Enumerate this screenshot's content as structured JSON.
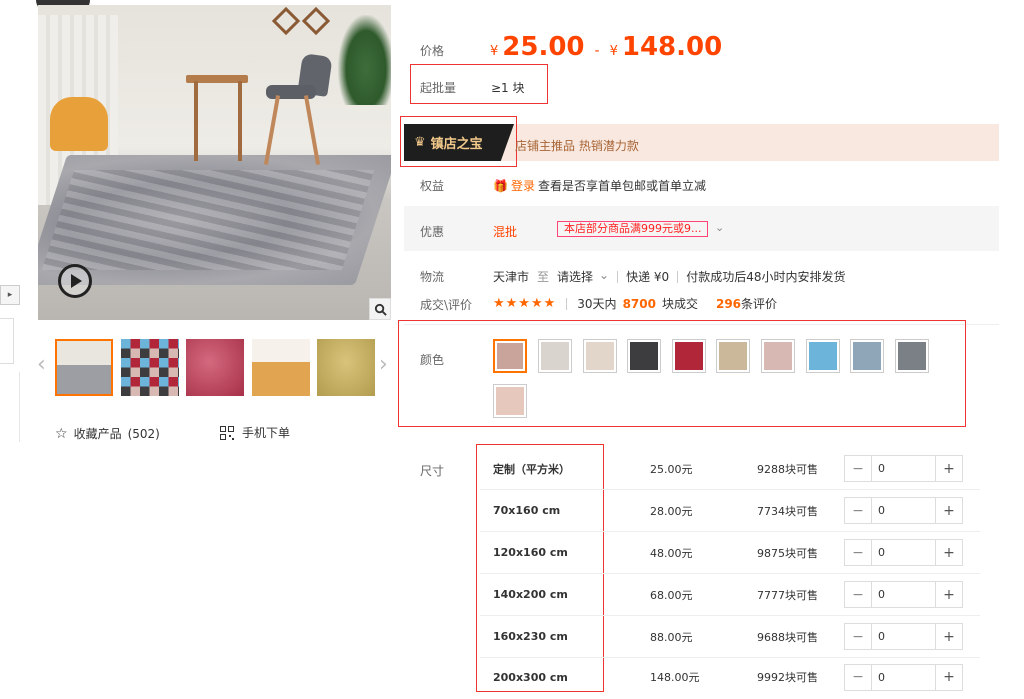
{
  "gallery": {
    "thumbnails": [
      "grey-rug-room",
      "color-swatches-grid",
      "red-shag-rug",
      "orange-rug",
      "olive-rug"
    ],
    "favorite_label": "收藏产品",
    "favorite_count": "(502)",
    "mobile_order_label": "手机下单"
  },
  "price": {
    "label": "价格",
    "currency": "¥",
    "low": "25.00",
    "dash": "-",
    "high": "148.00"
  },
  "moq": {
    "label": "起批量",
    "value": "≥1 块"
  },
  "banner": {
    "badge": "镇店之宝",
    "text": "店铺主推品  热销潜力款"
  },
  "rights": {
    "label": "权益",
    "login_link": "登录",
    "text": "查看是否享首单包邮或首单立减"
  },
  "discount": {
    "label": "优惠",
    "tag": "混批",
    "coupon": "本店部分商品满999元或9..."
  },
  "logistics": {
    "label": "物流",
    "from": "天津市",
    "to_label": "至",
    "destination": "请选择",
    "express": "快递 ¥0",
    "dispatch": "付款成功后48小时内安排发货"
  },
  "reviews": {
    "label": "成交\\评价",
    "stars": "★★★★★",
    "sold_prefix": "30天内",
    "sold_count": "8700",
    "sold_suffix": "块成交",
    "review_count": "296",
    "review_suffix": "条评价"
  },
  "color": {
    "label": "颜色",
    "swatches": [
      {
        "name": "swatch-1",
        "color": "#c8a49a"
      },
      {
        "name": "swatch-2",
        "color": "#d9d4ce"
      },
      {
        "name": "swatch-3",
        "color": "#e2d6cb"
      },
      {
        "name": "swatch-4",
        "color": "#3d3d3f"
      },
      {
        "name": "swatch-5",
        "color": "#b2263a"
      },
      {
        "name": "swatch-6",
        "color": "#cbb79a"
      },
      {
        "name": "swatch-7",
        "color": "#d8b8b2"
      },
      {
        "name": "swatch-8",
        "color": "#6db4da"
      },
      {
        "name": "swatch-9",
        "color": "#8fa6b8"
      },
      {
        "name": "swatch-10",
        "color": "#7b7f86"
      },
      {
        "name": "swatch-11",
        "color": "#e6c8bd"
      }
    ]
  },
  "sizes": {
    "label": "尺寸",
    "rows": [
      {
        "name": "定制（平方米）",
        "price": "25.00元",
        "stock": "9288块可售",
        "qty": "0"
      },
      {
        "name": "70x160 cm",
        "price": "28.00元",
        "stock": "7734块可售",
        "qty": "0"
      },
      {
        "name": "120x160 cm",
        "price": "48.00元",
        "stock": "9875块可售",
        "qty": "0"
      },
      {
        "name": "140x200 cm",
        "price": "68.00元",
        "stock": "7777块可售",
        "qty": "0"
      },
      {
        "name": "160x230 cm",
        "price": "88.00元",
        "stock": "9688块可售",
        "qty": "0"
      },
      {
        "name": "200x300 cm",
        "price": "148.00元",
        "stock": "9992块可售",
        "qty": "0"
      }
    ],
    "minus": "−",
    "plus": "+"
  }
}
